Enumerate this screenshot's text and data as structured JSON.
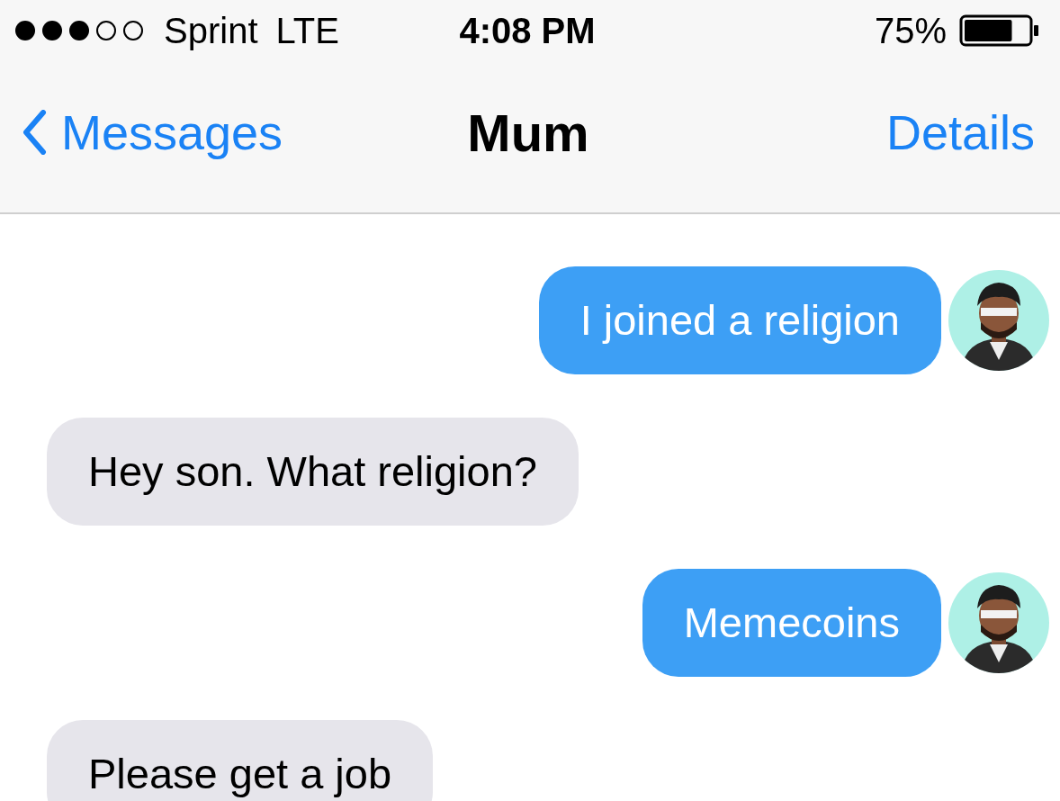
{
  "status_bar": {
    "carrier": "Sprint",
    "network": "LTE",
    "time": "4:08 PM",
    "battery_percent": "75%",
    "battery": {
      "level": 0.75
    }
  },
  "nav_bar": {
    "back": "Messages",
    "title": "Mum",
    "action": "Details"
  },
  "messages": [
    {
      "kind": "sent",
      "text": "I joined a religion"
    },
    {
      "kind": "received",
      "text": "Hey son. What religion?"
    },
    {
      "kind": "sent",
      "text": "Memecoins"
    },
    {
      "kind": "received",
      "text": "Please get a job"
    }
  ]
}
